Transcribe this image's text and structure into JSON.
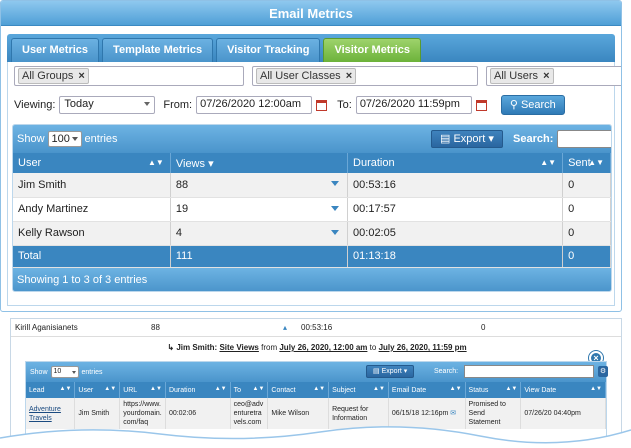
{
  "window": {
    "title": "Email Metrics"
  },
  "tabs": [
    {
      "label": "User Metrics",
      "active": false
    },
    {
      "label": "Template Metrics",
      "active": false
    },
    {
      "label": "Visitor Tracking",
      "active": false
    },
    {
      "label": "Visitor Metrics",
      "active": true
    }
  ],
  "filters": {
    "groups": "All Groups",
    "user_classes": "All User Classes",
    "users": "All Users"
  },
  "viewing": {
    "label": "Viewing:",
    "value": "Today",
    "from_label": "From:",
    "from_value": "07/26/2020 12:00am",
    "to_label": "To:",
    "to_value": "07/26/2020 11:59pm",
    "search_label": "Search"
  },
  "grid": {
    "show_label": "Show",
    "entries_value": "100",
    "entries_label": "entries",
    "export_label": "Export",
    "search_label": "Search:",
    "columns": [
      "User",
      "Views",
      "Duration",
      "Sent"
    ],
    "rows": [
      {
        "user": "Jim Smith",
        "views": "88",
        "duration": "00:53:16",
        "sent": "0"
      },
      {
        "user": "Andy Martinez",
        "views": "19",
        "duration": "00:17:57",
        "sent": "0"
      },
      {
        "user": "Kelly Rawson",
        "views": "4",
        "duration": "00:02:05",
        "sent": "0"
      }
    ],
    "total": {
      "label": "Total",
      "views": "111",
      "duration": "01:13:18",
      "sent": "0"
    },
    "footer": "Showing 1 to 3 of 3 entries"
  },
  "panel2": {
    "row": {
      "user": "Kirill Aganisianets",
      "views": "88",
      "duration": "00:53:16",
      "sent": "0"
    },
    "detail_title": {
      "name": "Jim Smith:",
      "site_views": "Site Views",
      "from": "from",
      "start": "July 26, 2020, 12:00 am",
      "to": "to",
      "end": "July 26, 2020, 11:59 pm"
    },
    "toolbar": {
      "show_label": "Show",
      "entries_value": "10",
      "entries_label": "entries",
      "export_label": "Export",
      "search_label": "Search:"
    },
    "columns": [
      "Lead",
      "User",
      "URL",
      "Duration",
      "To",
      "Contact",
      "Subject",
      "Email Date",
      "Status",
      "View Date"
    ],
    "rows": [
      {
        "lead": "Adventure Travels",
        "user": "Jim Smith",
        "url": "https://www.yourdomain.com/faq",
        "duration": "00:02:06",
        "to": "ceo@adventuretravels.com",
        "contact": "Mike Wilson",
        "subject": "Request for Information",
        "email_date": "06/15/18 12:16pm",
        "status": "Promised to Send Statement",
        "view_date": "07/26/20 04:40pm"
      }
    ]
  },
  "colors": {
    "header_blue": "#3a86c0",
    "active_tab_green": "#6cb23a",
    "title_bar": "#4f9fd6"
  }
}
